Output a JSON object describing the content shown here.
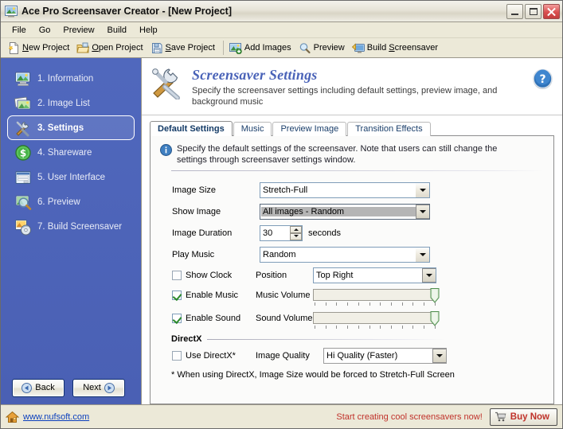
{
  "window": {
    "title": "Ace Pro Screensaver Creator  - [New Project]",
    "app_icon": "app-image-icon",
    "buttons": {
      "minimize": "minimize-button",
      "maximize": "maximize-button",
      "close": "close-button"
    }
  },
  "menubar": {
    "items": [
      {
        "label": "File"
      },
      {
        "label": "Go"
      },
      {
        "label": "Preview"
      },
      {
        "label": "Build"
      },
      {
        "label": "Help"
      }
    ]
  },
  "toolbar": {
    "buttons": [
      {
        "label": "New Project",
        "accel": "N",
        "icon": "new-document-icon"
      },
      {
        "label": "Open Project",
        "accel": "O",
        "icon": "open-folder-icon"
      },
      {
        "label": "Save Project",
        "accel": "S",
        "icon": "save-disk-icon"
      },
      {
        "label": "Add Images",
        "accel": "",
        "icon": "add-images-icon"
      },
      {
        "label": "Preview",
        "accel": "",
        "icon": "magnifier-icon"
      },
      {
        "label": "Build Screensaver",
        "accel": "S",
        "icon": "build-monitor-icon"
      }
    ]
  },
  "sidebar": {
    "items": [
      {
        "label": "1. Information",
        "icon": "monitor-info-icon",
        "selected": false
      },
      {
        "label": "2. Image List",
        "icon": "image-list-icon",
        "selected": false
      },
      {
        "label": "3. Settings",
        "icon": "tools-wrench-icon",
        "selected": true
      },
      {
        "label": "4. Shareware",
        "icon": "dollar-icon",
        "selected": false
      },
      {
        "label": "5. User Interface",
        "icon": "window-ui-icon",
        "selected": false
      },
      {
        "label": "6. Preview",
        "icon": "preview-magnifier-icon",
        "selected": false
      },
      {
        "label": "7. Build Screensaver",
        "icon": "build-cd-icon",
        "selected": false
      }
    ],
    "back_label": "Back",
    "next_label": "Next"
  },
  "page": {
    "icon": "tools-wrench-large-icon",
    "title": "Screensaver Settings",
    "subtitle": "Specify the screensaver settings including default settings, preview image, and background music",
    "help_icon": "help-question-icon"
  },
  "tabs": [
    {
      "label": "Default Settings",
      "active": true
    },
    {
      "label": "Music",
      "active": false
    },
    {
      "label": "Preview Image",
      "active": false
    },
    {
      "label": "Transition Effects",
      "active": false
    }
  ],
  "settings": {
    "info_icon": "info-icon",
    "info_text": "Specify the default settings of the screensaver. Note that users can still change the settings through screensaver settings window.",
    "fields": {
      "image_size": {
        "label": "Image Size",
        "value": "Stretch-Full",
        "focused": false
      },
      "show_image": {
        "label": "Show Image",
        "value": "All images - Random",
        "focused": true
      },
      "image_duration": {
        "label": "Image Duration",
        "value": "30",
        "unit": "seconds"
      },
      "play_music": {
        "label": "Play Music",
        "value": "Random",
        "focused": false
      },
      "position": {
        "label": "Position",
        "value": "Top Right"
      },
      "music_volume": {
        "label": "Music Volume",
        "value": 100
      },
      "sound_volume": {
        "label": "Sound Volume",
        "value": 100
      }
    },
    "checkboxes": {
      "show_clock": {
        "label": "Show Clock",
        "checked": false
      },
      "enable_music": {
        "label": "Enable Music",
        "checked": true
      },
      "enable_sound": {
        "label": "Enable Sound",
        "checked": true
      }
    },
    "directx": {
      "group_label": "DirectX",
      "use_directx": {
        "label": "Use DirectX*",
        "checked": false
      },
      "image_quality": {
        "label": "Image Quality",
        "value": "Hi Quality (Faster)",
        "disabled": true
      },
      "note": "* When using DirectX, Image Size would be forced to Stretch-Full Screen"
    }
  },
  "statusbar": {
    "home_icon": "home-icon",
    "link": "www.nufsoft.com",
    "promo": "Start creating cool screensavers now!",
    "buy_label": "Buy Now",
    "cart_icon": "shopping-cart-icon"
  },
  "colors": {
    "sidebar_blue": "#4a63b8",
    "title_accent": "#4a63b8",
    "promo_red": "#c0322b",
    "link_blue": "#0b3fbd",
    "tab_text": "#133a66"
  }
}
